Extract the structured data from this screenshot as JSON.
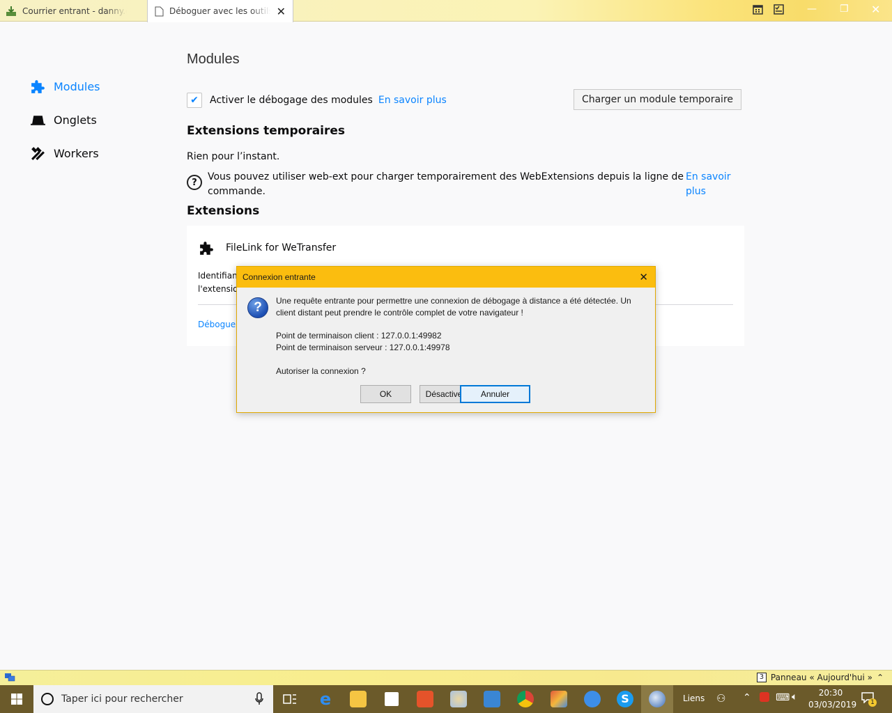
{
  "tabs": [
    {
      "title": "Courrier entrant - danny.darbie"
    },
    {
      "title": "Déboguer avec les outils de"
    }
  ],
  "sidebar": {
    "items": [
      {
        "label": "Modules",
        "active": true
      },
      {
        "label": "Onglets",
        "active": false
      },
      {
        "label": "Workers",
        "active": false
      }
    ]
  },
  "main": {
    "title": "Modules",
    "enable_debug_label": "Activer le débogage des modules",
    "enable_debug_checked": true,
    "learn_more": "En savoir plus",
    "load_temp_button": "Charger un module temporaire",
    "temp_extensions_heading": "Extensions temporaires",
    "nothing_yet": "Rien pour l’instant.",
    "webext_info_line1": "Vous pouvez utiliser web-ext pour charger temporairement des WebExtensions depuis la ligne de",
    "webext_info_line2": "commande.",
    "learn_more_line1": "En savoir",
    "learn_more_line2": "plus",
    "extensions_heading": "Extensions",
    "extension": {
      "name": "FileLink for WeTransfer",
      "ident_line1": "Identifiant",
      "ident_line2": "l'extension",
      "debug_link": "Déboguer"
    }
  },
  "dialog": {
    "title": "Connexion entrante",
    "message_line1": "Une requête entrante pour permettre une connexion de débogage à distance a été détectée. Un",
    "message_line2": "client distant peut prendre le contrôle complet de votre navigateur !",
    "client_endpoint": "Point de terminaison client : 127.0.0.1:49982",
    "server_endpoint": "Point de terminaison serveur : 127.0.0.1:49978",
    "question": "Autoriser la connexion ?",
    "buttons": {
      "ok": "OK",
      "disable": "Désactiver",
      "cancel": "Annuler"
    }
  },
  "statusbar": {
    "panel_badge": "3",
    "panel_label": "Panneau « Aujourd'hui »"
  },
  "taskbar": {
    "search_placeholder": "Taper ici pour rechercher",
    "links_label": "Liens",
    "time": "20:30",
    "date": "03/03/2019",
    "notification_count": "1"
  },
  "colors": {
    "accent": "#0a84ff",
    "dialog_title": "#fbbd0f",
    "taskbar": "#6b5a2a"
  }
}
